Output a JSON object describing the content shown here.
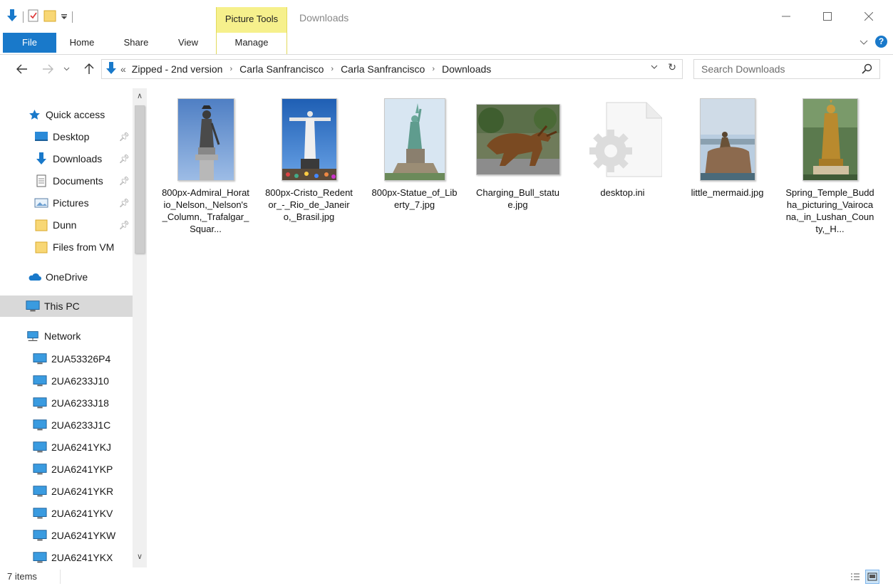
{
  "window": {
    "title": "Downloads",
    "context_tab_group": "Picture Tools"
  },
  "ribbon": {
    "tabs": [
      {
        "label": "File"
      },
      {
        "label": "Home"
      },
      {
        "label": "Share"
      },
      {
        "label": "View"
      },
      {
        "label": "Manage"
      }
    ]
  },
  "address": {
    "overflow": "«",
    "breadcrumbs": [
      "Zipped - 2nd version",
      "Carla Sanfrancisco",
      "Carla Sanfrancisco",
      "Downloads"
    ]
  },
  "search": {
    "placeholder": "Search Downloads"
  },
  "sidebar": {
    "items": [
      {
        "label": "Quick access",
        "icon": "star-icon",
        "pinned": false
      },
      {
        "label": "Desktop",
        "icon": "desktop-icon",
        "pinned": true
      },
      {
        "label": "Downloads",
        "icon": "download-arrow-icon",
        "pinned": true
      },
      {
        "label": "Documents",
        "icon": "document-icon",
        "pinned": true
      },
      {
        "label": "Pictures",
        "icon": "pictures-icon",
        "pinned": true
      },
      {
        "label": "Dunn",
        "icon": "folder-icon",
        "pinned": true
      },
      {
        "label": "Files from VM",
        "icon": "folder-icon",
        "pinned": false
      },
      {
        "label": "OneDrive",
        "icon": "cloud-icon",
        "pinned": false
      },
      {
        "label": "This PC",
        "icon": "monitor-icon",
        "pinned": false,
        "selected": true
      },
      {
        "label": "Network",
        "icon": "network-icon",
        "pinned": false
      },
      {
        "label": "2UA53326P4",
        "icon": "monitor-icon"
      },
      {
        "label": "2UA6233J10",
        "icon": "monitor-icon"
      },
      {
        "label": "2UA6233J18",
        "icon": "monitor-icon"
      },
      {
        "label": "2UA6233J1C",
        "icon": "monitor-icon"
      },
      {
        "label": "2UA6241YKJ",
        "icon": "monitor-icon"
      },
      {
        "label": "2UA6241YKP",
        "icon": "monitor-icon"
      },
      {
        "label": "2UA6241YKR",
        "icon": "monitor-icon"
      },
      {
        "label": "2UA6241YKV",
        "icon": "monitor-icon"
      },
      {
        "label": "2UA6241YKW",
        "icon": "monitor-icon"
      },
      {
        "label": "2UA6241YKX",
        "icon": "monitor-icon"
      }
    ]
  },
  "files": [
    {
      "name": "800px-Admiral_Horatio_Nelson,_Nelson's_Column,_Trafalgar_Squar...",
      "kind": "image",
      "subject": "nelson-column-statue"
    },
    {
      "name": "800px-Cristo_Redentor_-_Rio_de_Janeiro,_Brasil.jpg",
      "kind": "image",
      "subject": "cristo-redentor-statue"
    },
    {
      "name": "800px-Statue_of_Liberty_7.jpg",
      "kind": "image",
      "subject": "statue-of-liberty"
    },
    {
      "name": "Charging_Bull_statue.jpg",
      "kind": "image",
      "subject": "charging-bull-statue"
    },
    {
      "name": "desktop.ini",
      "kind": "settings-file",
      "subject": "gear-file-icon"
    },
    {
      "name": "little_mermaid.jpg",
      "kind": "image",
      "subject": "little-mermaid-statue"
    },
    {
      "name": "Spring_Temple_Buddha_picturing_Vairocana,_in_Lushan_County,_H...",
      "kind": "image",
      "subject": "spring-temple-buddha"
    }
  ],
  "status": {
    "item_count": "7 items"
  },
  "colors": {
    "accent": "#1979ca",
    "context_tab": "#f6f08c",
    "selected_nav": "#d9d9d9"
  }
}
